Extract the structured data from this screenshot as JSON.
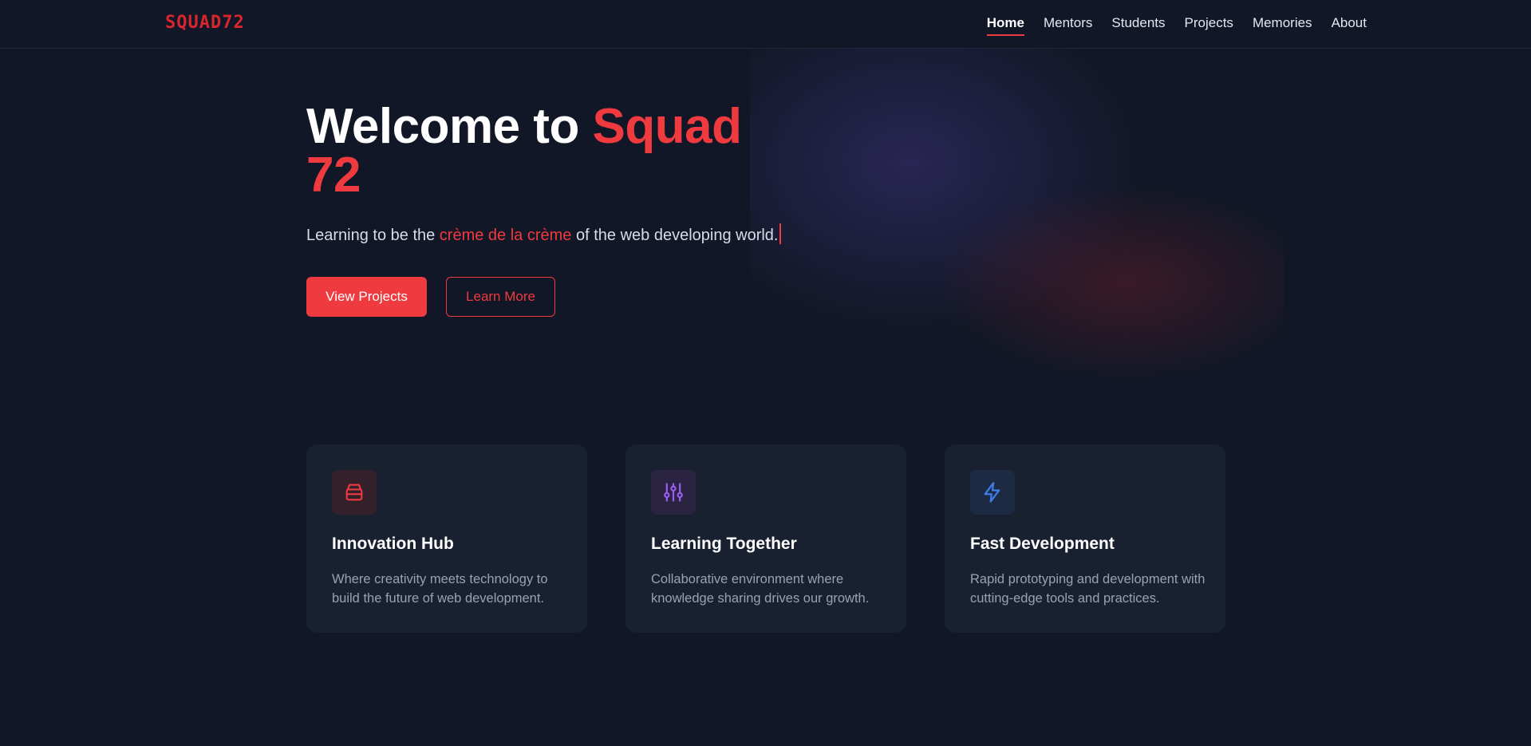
{
  "nav": {
    "logo": "SQUAD72",
    "links": [
      "Home",
      "Mentors",
      "Students",
      "Projects",
      "Memories",
      "About"
    ],
    "active": "Home"
  },
  "hero": {
    "title_prefix": "Welcome to ",
    "title_accent": "Squad 72",
    "subtitle_before": "Learning to be the ",
    "subtitle_accent": "crème de la crème",
    "subtitle_after": " of the web developing world.",
    "primary_button": "View Projects",
    "secondary_button": "Learn More"
  },
  "features": [
    {
      "icon": "box-icon",
      "title": "Innovation Hub",
      "desc": "Where creativity meets technology to build the future of web development."
    },
    {
      "icon": "sliders-icon",
      "title": "Learning Together",
      "desc": "Collaborative environment where knowledge sharing drives our growth."
    },
    {
      "icon": "lightning-icon",
      "title": "Fast Development",
      "desc": "Rapid prototyping and development with cutting-edge tools and practices."
    }
  ],
  "colors": {
    "background": "#111726",
    "accent": "#ef3a3f",
    "card": "#192030",
    "purple_icon": "#9b5cf0",
    "blue_icon": "#3f7ee8"
  }
}
